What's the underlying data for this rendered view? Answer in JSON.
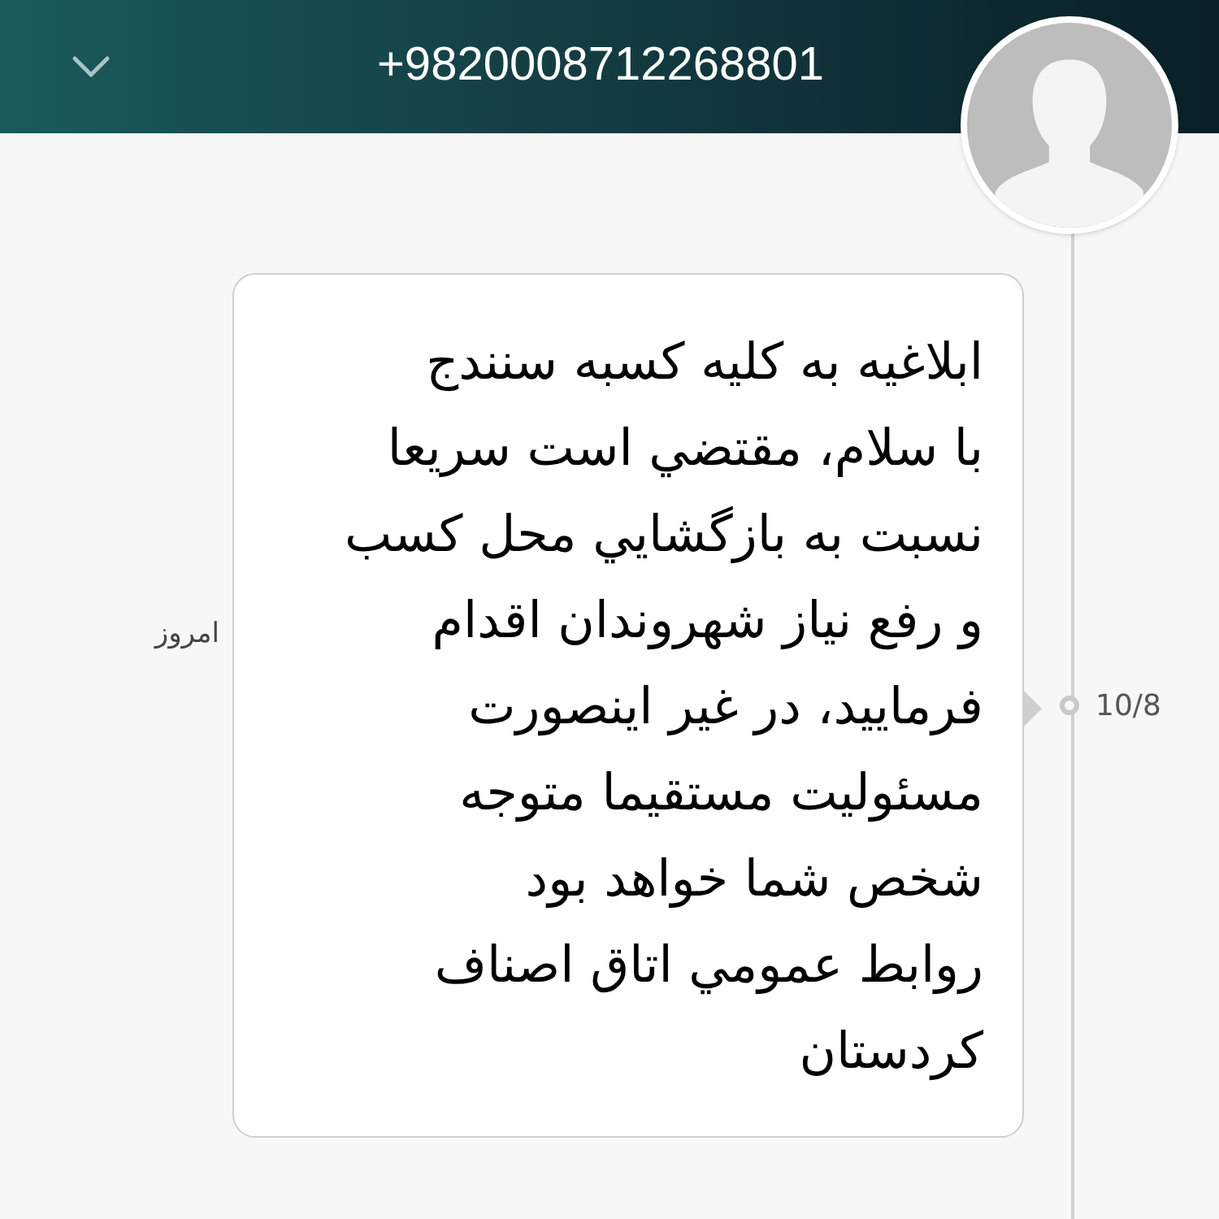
{
  "header": {
    "title": "+9820008712268801"
  },
  "message": {
    "time": "امروز",
    "date": "10/8",
    "text": "ابلاغيه به كليه كسبه سنندج\nبا سلام، مقتضي است سريعا\nنسبت به بازگشايي محل كسب\nو رفع نياز شهروندان اقدام\nفرماييد، در غير اينصورت\nمسئوليت مستقيما متوجه\nشخص شما خواهد بود\nروابط عمومي اتاق اصناف\nكردستان"
  }
}
